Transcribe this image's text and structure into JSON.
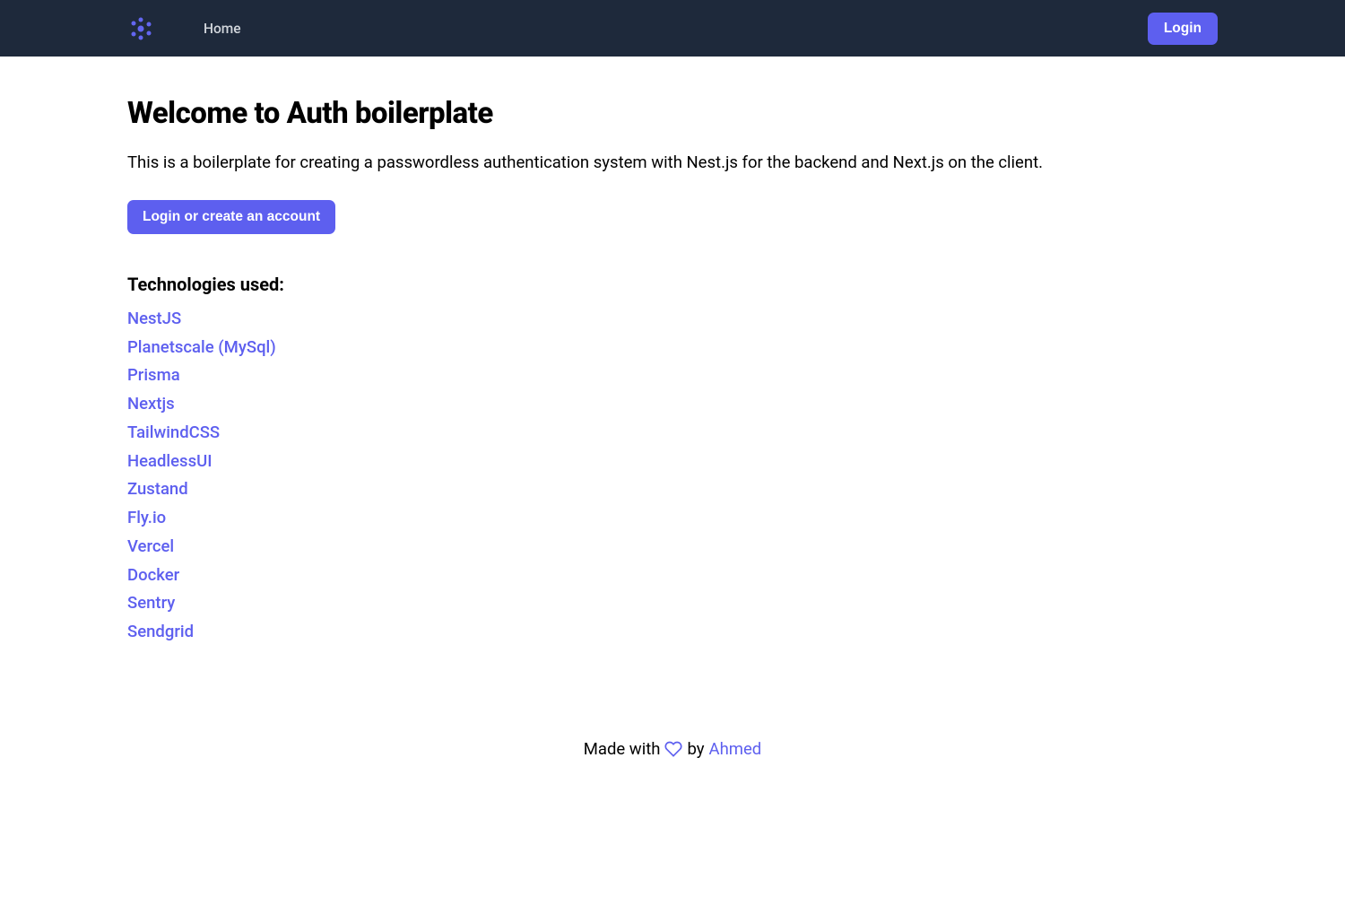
{
  "navbar": {
    "home_label": "Home",
    "login_label": "Login"
  },
  "main": {
    "title": "Welcome to Auth boilerplate",
    "description": "This is a boilerplate for creating a passwordless authentication system with Nest.js for the backend and Next.js on the client.",
    "cta_label": "Login or create an account",
    "tech_heading": "Technologies used:",
    "technologies": [
      "NestJS",
      "Planetscale (MySql)",
      "Prisma",
      "Nextjs",
      "TailwindCSS",
      "HeadlessUI",
      "Zustand",
      "Fly.io",
      "Vercel",
      "Docker",
      "Sentry",
      "Sendgrid"
    ]
  },
  "footer": {
    "prefix": "Made with",
    "suffix": "by",
    "author": "Ahmed"
  }
}
